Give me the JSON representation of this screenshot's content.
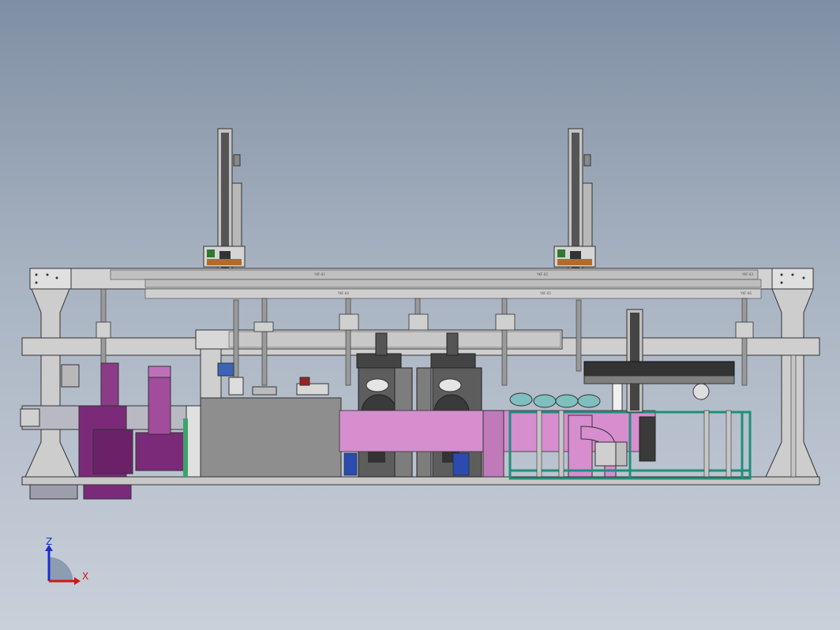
{
  "view": {
    "background_top": "#7f8fa3",
    "background_bottom": "#c9d0da"
  },
  "model": {
    "frame_color": "#c8c8c8",
    "purple_color": "#7a2a78",
    "pink_color": "#d08ec8",
    "teal_color": "#1f8f7a",
    "dark_color": "#3a3a3a"
  },
  "labels": {
    "beam_tags": [
      "YKF-01",
      "YKF-02",
      "YKF-03",
      "YKF-04",
      "YKF-05",
      "YKF-06"
    ]
  },
  "triad": {
    "z_label": "Z",
    "x_label": "X",
    "z_color": "#1a2fc8",
    "x_color": "#d01818"
  }
}
